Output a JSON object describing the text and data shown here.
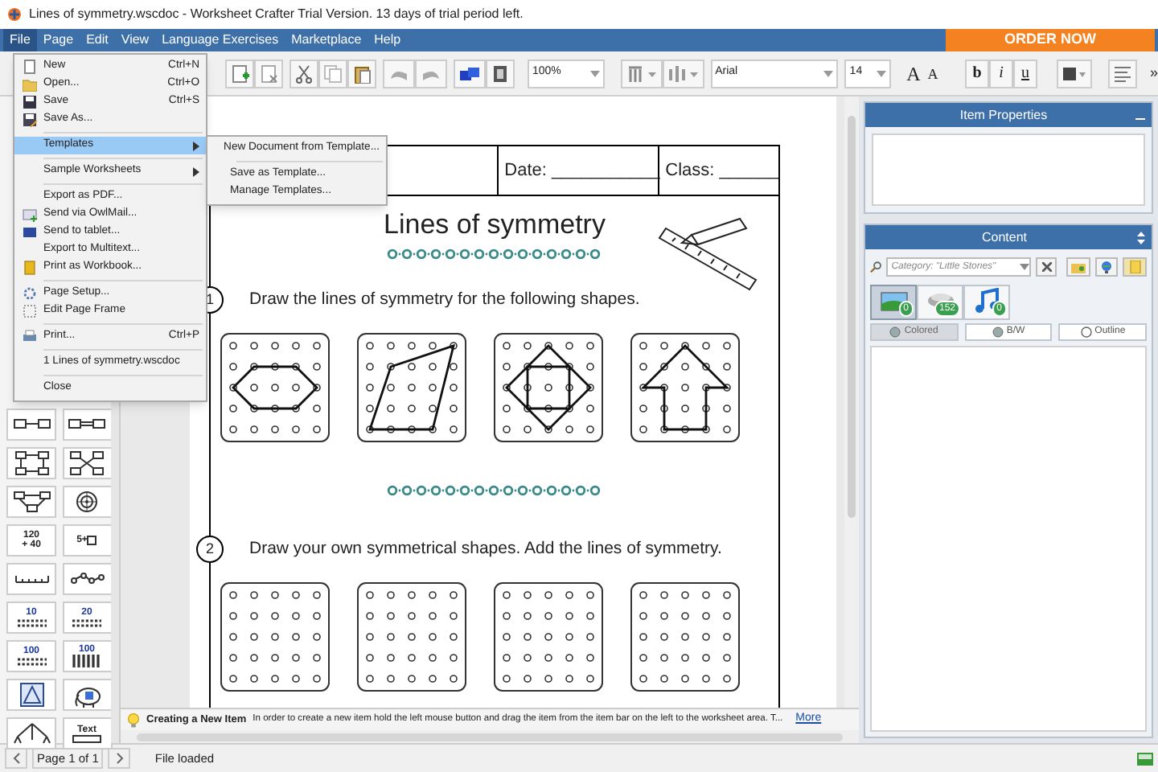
{
  "window": {
    "title": "Lines of symmetry.wscdoc  - Worksheet Crafter Trial Version. 13 days of trial period left."
  },
  "menu_bar": {
    "items": [
      {
        "label": "File",
        "selected": true
      },
      {
        "label": "Page",
        "selected": false
      },
      {
        "label": "Edit",
        "selected": false
      },
      {
        "label": "View",
        "selected": false
      },
      {
        "label": "Language Exercises",
        "selected": false
      },
      {
        "label": "Marketplace",
        "selected": false
      },
      {
        "label": "Help",
        "selected": false
      }
    ],
    "order_button": "ORDER NOW"
  },
  "file_menu": {
    "items": [
      {
        "kind": "item",
        "label": "New",
        "shortcut": "Ctrl+N",
        "selected": false
      },
      {
        "kind": "item",
        "label": "Open...",
        "shortcut": "Ctrl+O",
        "selected": false
      },
      {
        "kind": "item",
        "label": "Save",
        "shortcut": "Ctrl+S",
        "selected": false
      },
      {
        "kind": "item",
        "label": "Save As...",
        "selected": false
      },
      {
        "kind": "separator"
      },
      {
        "kind": "submenu",
        "label": "Templates",
        "selected": true
      },
      {
        "kind": "separator"
      },
      {
        "kind": "submenu",
        "label": "Sample Worksheets",
        "selected": false
      },
      {
        "kind": "separator"
      },
      {
        "kind": "item",
        "label": "Export as PDF...",
        "selected": false
      },
      {
        "kind": "item",
        "label": "Send via OwlMail...",
        "selected": false
      },
      {
        "kind": "item",
        "label": "Send to tablet...",
        "selected": false
      },
      {
        "kind": "item",
        "label": "Export to Multitext...",
        "selected": false
      },
      {
        "kind": "item",
        "label": "Print as Workbook...",
        "selected": false
      },
      {
        "kind": "separator"
      },
      {
        "kind": "item",
        "label": "Page Setup...",
        "selected": false
      },
      {
        "kind": "item",
        "label": "Edit Page Frame",
        "selected": false
      },
      {
        "kind": "separator"
      },
      {
        "kind": "item",
        "label": "Print...",
        "shortcut": "Ctrl+P",
        "selected": false
      },
      {
        "kind": "separator"
      },
      {
        "kind": "item",
        "label": "1 Lines of symmetry.wscdoc",
        "selected": false
      },
      {
        "kind": "separator"
      },
      {
        "kind": "item",
        "label": "Close",
        "selected": false
      }
    ]
  },
  "templates_submenu": {
    "items": [
      {
        "kind": "item",
        "label": "New Document from Template..."
      },
      {
        "kind": "separator"
      },
      {
        "kind": "item",
        "label": "Save as Template..."
      },
      {
        "kind": "item",
        "label": "Manage Templates..."
      }
    ]
  },
  "toolbar": {
    "zoom": "100%",
    "font": "Arial",
    "font_size": "14",
    "grow_font": "A",
    "shrink_font": "A",
    "bold": "b",
    "italic": "i",
    "underline": "u",
    "overflow": "»"
  },
  "item_sidebar": {
    "tiles": [
      {
        "kind": "arrow-boxes"
      },
      {
        "kind": "double-arrow-boxes"
      },
      {
        "kind": "flow-square"
      },
      {
        "kind": "flow-cross"
      },
      {
        "kind": "flow-tree"
      },
      {
        "kind": "target"
      },
      {
        "kind": "sum",
        "lines": [
          "120",
          "+ 40"
        ]
      },
      {
        "kind": "equation",
        "lines": [
          "5+"
        ]
      },
      {
        "kind": "number-line"
      },
      {
        "kind": "dot-line"
      },
      {
        "kind": "dots",
        "lines": [
          "10"
        ]
      },
      {
        "kind": "dots",
        "lines": [
          "20"
        ]
      },
      {
        "kind": "dots",
        "lines": [
          "100"
        ]
      },
      {
        "kind": "abacus",
        "lines": [
          "100"
        ]
      },
      {
        "kind": "triangle"
      },
      {
        "kind": "elephant"
      },
      {
        "kind": "tree"
      },
      {
        "kind": "text",
        "lines": [
          "Text"
        ]
      }
    ]
  },
  "worksheet": {
    "header": [
      "Date: ___________",
      "Class: ______"
    ],
    "title": "Lines of symmetry",
    "tasks": [
      {
        "number": "1",
        "text": "Draw the lines of symmetry for the following shapes.",
        "boards": [
          {
            "kind": "hexagon"
          },
          {
            "kind": "parallelogram"
          },
          {
            "kind": "diamond"
          },
          {
            "kind": "arrow"
          }
        ]
      },
      {
        "number": "2",
        "text": "Draw your own symmetrical shapes. Add the lines of symmetry.",
        "boards": [
          {
            "kind": "empty"
          },
          {
            "kind": "empty"
          },
          {
            "kind": "empty"
          },
          {
            "kind": "empty"
          }
        ]
      }
    ]
  },
  "tip": {
    "title": "Creating a New Item",
    "text": "In order to create a new item hold the left mouse button and drag the item from the item bar on the left to the worksheet area. T...",
    "link": "More"
  },
  "right_panel": {
    "item_properties": {
      "title": "Item Properties"
    },
    "content": {
      "title": "Content",
      "category_field": {
        "placeholder": "Category: \"Little Stories\""
      },
      "tabs": [
        {
          "kind": "images",
          "count": "0",
          "selected": true
        },
        {
          "kind": "shapes",
          "count": "152",
          "selected": false
        },
        {
          "kind": "sounds",
          "count": "0",
          "selected": false
        }
      ],
      "color_modes": [
        {
          "label": "Colored",
          "selected": true
        },
        {
          "label": "B/W",
          "selected": false
        },
        {
          "label": "Outline",
          "selected": false
        }
      ]
    }
  },
  "status_bar": {
    "page": "Page 1 of 1",
    "message": "File loaded"
  }
}
